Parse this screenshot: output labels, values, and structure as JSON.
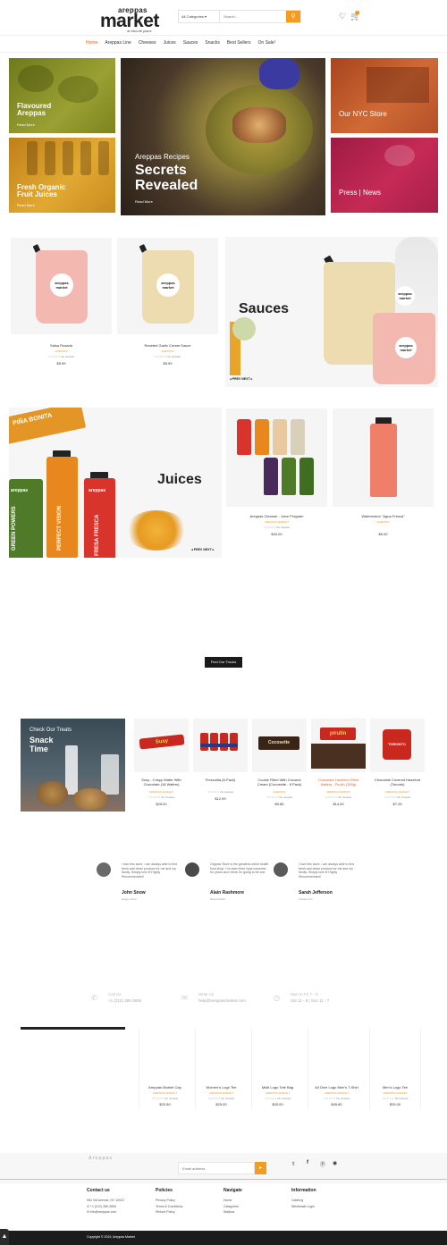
{
  "header": {
    "logo_small": "areppas",
    "logo_big": "market",
    "logo_tagline": "at biscotti place",
    "category_select": "All Categories",
    "search_placeholder": "Search..."
  },
  "nav": [
    "Home",
    "Areppas Line",
    "Cheeses",
    "Juices",
    "Sauces",
    "Snacks",
    "Best Sellers",
    "On Sale!"
  ],
  "banners": {
    "flavoured": "Flavoured\nAreppas",
    "flavoured_link": "Read More",
    "juices": "Fresh Organic\nFruit Juices",
    "juices_link": "Read More",
    "recipes_sub": "Areppas Recipes",
    "recipes_title": "Secrets\nRevealed",
    "recipes_link": "Read More",
    "nyc": "Our NYC Store",
    "press": "Press | News"
  },
  "sauces": {
    "title": "Sauces",
    "prev": "PREV",
    "next": "NEXT",
    "products": [
      {
        "name": "Salsa Rosada",
        "brand": "AREPPAS",
        "reviews": "No reviews",
        "price": "$5.99"
      },
      {
        "name": "Reseted Garlic Cream Sauce",
        "brand": "AREPPAS",
        "reviews": "No reviews",
        "price": "$5.99"
      }
    ],
    "pouch_logo": "areppas\nmarket"
  },
  "juices": {
    "title": "Juices",
    "prev": "PREV",
    "next": "NEXT",
    "bottle_labels": [
      "PIÑA BONITA",
      "PERFECT VISION",
      "FRESA FRESCA",
      "GREEN POWERS",
      "areppas",
      "areppas"
    ],
    "products": [
      {
        "name": "Areppas Cleanse - Juice Program",
        "brand": "AREPPAS MARKET",
        "reviews": "No reviews",
        "price": "$40.00"
      },
      {
        "name": "Watermelon \"Agua Fresca\"",
        "brand": "AREPPAS",
        "reviews": "",
        "price": "$6.00"
      }
    ]
  },
  "trucks_button": "Find Our Trucks",
  "snacks": {
    "banner_line1": "Check Our Treats",
    "banner_line2": "Snack\nTime",
    "products": [
      {
        "name": "Susy - Crispy Wafer With Chocolate (18 Wafers)",
        "brand": "AREPPAS MARKET",
        "reviews": "No reviews",
        "price": "$25.00",
        "pkg": "Susy"
      },
      {
        "name": "Frescolita (6-Pack)",
        "brand": "",
        "reviews": "No reviews",
        "price": "$12.99",
        "pkg": ""
      },
      {
        "name": "Cookie Filled With Coconut Cream (Cocosette - 6 Pack)",
        "brand": "AREPPAS",
        "reviews": "No reviews",
        "price": "$9.85",
        "pkg": "Cocosette"
      },
      {
        "name": "Chocolate Hazelnut Filled Wafers - Pirulin (300g)",
        "brand": "AREPPAS MARKET",
        "reviews": "No reviews",
        "price": "$14.00",
        "pkg": "pirulin"
      },
      {
        "name": "Chocolate Covered Hazelnut (Toronto)",
        "brand": "AREPPAS MARKET",
        "reviews": "No reviews",
        "price": "$7.25",
        "pkg": "TORONTO"
      }
    ]
  },
  "testimonials": [
    {
      "text": "I love this store. I am always able to find fresh and clean produce for me and my family. Simply love it! Highly Recommended!",
      "name": "John Snow",
      "role": "Happy client"
    },
    {
      "text": "Organic Store is the greatest online health food shop. I've been their loyal customer for years and I think I'm going to be one.",
      "name": "Alain Rashmore",
      "role": "Brand Addict"
    },
    {
      "text": "I love this store. I am always able to find fresh and clean produce for me and my family. Simply love it! Highly Recommended!",
      "name": "Sarah Jefferson",
      "role": "Chosen Kin"
    }
  ],
  "contact_bar": [
    {
      "label": "Call Us",
      "value": "+1 (212) 355-3655"
    },
    {
      "label": "Write Us",
      "value": "help@areppasmarket.com"
    },
    {
      "label": "Mon to Fri 7 - 9",
      "value": "Sat 11 - 8 | Sun 11 - 7"
    }
  ],
  "merch": [
    {
      "name": "Areppas Market Cap",
      "brand": "AREPPAS MARKET",
      "reviews": "No reviews",
      "price": "$20.50"
    },
    {
      "name": "Women's Logo Tee",
      "brand": "AREPPAS MARKET",
      "reviews": "No reviews",
      "price": "$25.00"
    },
    {
      "name": "Multi Logo Tote Bag",
      "brand": "AREPPAS MARKET",
      "reviews": "No reviews",
      "price": "$25.00"
    },
    {
      "name": "All Over Logo Men's T-Shirt",
      "brand": "AREPPAS MARKET",
      "reviews": "No reviews",
      "price": "$45.80"
    },
    {
      "name": "Men's Logo Tee",
      "brand": "AREPPAS MARKET",
      "reviews": "No reviews",
      "price": "$25.00"
    }
  ],
  "newsletter": {
    "label": "Areppas",
    "placeholder": "Email address"
  },
  "footer": {
    "contact_title": "Contact us",
    "contact_lines": [
      "954 3rd Avenue, NY 10022",
      "+1 (212) 355-3655",
      "info@areppas.com"
    ],
    "policies_title": "Policies",
    "policies": [
      "Privacy Policy",
      "Terms & Conditions",
      "Refund Policy"
    ],
    "navigate_title": "Navigate",
    "navigate": [
      "Home",
      "Categories",
      "Wallpax"
    ],
    "info_title": "Information",
    "info": [
      "Catering",
      "Wholesale Login"
    ],
    "copyright": "Copyright © 2019, Areppas Market"
  },
  "colors": {
    "accent": "#f39c1f",
    "nav_active": "#e8622c",
    "olive": "#8a8f21",
    "mustard": "#d9a024",
    "rust": "#c5562a",
    "magenta": "#b41d4a"
  }
}
